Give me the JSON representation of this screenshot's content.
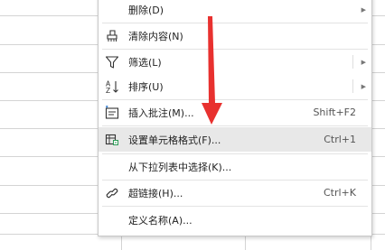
{
  "context_menu": {
    "items": [
      {
        "label": "删除(D)",
        "shortcut": "",
        "has_submenu": true
      },
      {
        "label": "清除内容(N)",
        "shortcut": "",
        "has_submenu": false
      },
      {
        "label": "筛选(L)",
        "shortcut": "",
        "has_submenu": true
      },
      {
        "label": "排序(U)",
        "shortcut": "",
        "has_submenu": true
      },
      {
        "label": "插入批注(M)...",
        "shortcut": "Shift+F2",
        "has_submenu": false
      },
      {
        "label": "设置单元格格式(F)...",
        "shortcut": "Ctrl+1",
        "has_submenu": false,
        "highlighted": true
      },
      {
        "label": "从下拉列表中选择(K)...",
        "shortcut": "",
        "has_submenu": false
      },
      {
        "label": "超链接(H)...",
        "shortcut": "Ctrl+K",
        "has_submenu": false
      },
      {
        "label": "定义名称(A)...",
        "shortcut": "",
        "has_submenu": false
      }
    ]
  },
  "icons": {
    "eraser": "eraser-icon",
    "filter": "filter-icon",
    "sort": "sort-az-icon",
    "comment": "comment-icon",
    "format": "format-cells-icon",
    "link": "hyperlink-icon"
  },
  "colors": {
    "highlight": "#e8e8e8",
    "annotation_arrow": "#e8312f"
  }
}
